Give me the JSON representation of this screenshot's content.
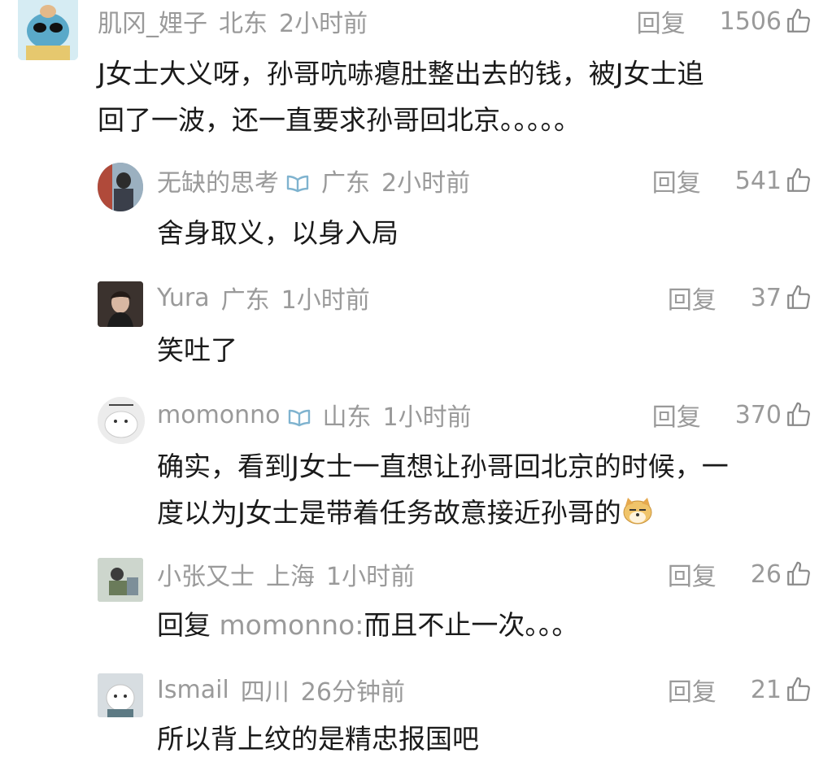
{
  "comments": [
    {
      "user": "肌冈_娌子",
      "location": "北东",
      "time": "2小时前",
      "reply_label": "回复",
      "likes": "1506",
      "vip": false,
      "text_lines": [
        "J女士大义呀，孙哥吭哧瘪肚整出去的钱，被J女士追",
        "回了一波，还一直要求孙哥回北京。。。。。"
      ]
    },
    {
      "user": "无缺的思考",
      "location": "广东",
      "time": "2小时前",
      "reply_label": "回复",
      "likes": "541",
      "vip": true,
      "text_lines": [
        "舍身取义，以身入局"
      ]
    },
    {
      "user": "Yura",
      "location": "广东",
      "time": "1小时前",
      "reply_label": "回复",
      "likes": "37",
      "vip": false,
      "text_lines": [
        "笑吐了"
      ]
    },
    {
      "user": "momonno",
      "location": "山东",
      "time": "1小时前",
      "reply_label": "回复",
      "likes": "370",
      "vip": true,
      "text_lines": [
        "确实，看到J女士一直想让孙哥回北京的时候，一",
        "度以为J女士是带着任务故意接近孙哥的"
      ],
      "emoji": "doge-emoji"
    },
    {
      "user": "小张又士",
      "location": "上海",
      "time": "1小时前",
      "reply_label": "回复",
      "likes": "26",
      "vip": false,
      "reply_prefix": "回复",
      "reply_to": "momonno:",
      "text_lines": [
        "而且不止一次。。。"
      ]
    },
    {
      "user": "Ismail",
      "location": "四川",
      "time": "26分钟前",
      "reply_label": "回复",
      "likes": "21",
      "vip": false,
      "text_lines": [
        "所以背上纹的是精忠报国吧"
      ]
    }
  ],
  "icons": {
    "like": "thumbs-up-icon",
    "vip": "book-badge-icon"
  },
  "colors": {
    "meta": "#9a9a9a",
    "text": "#1a1a1a",
    "vip_badge": "#7fb3cf"
  }
}
